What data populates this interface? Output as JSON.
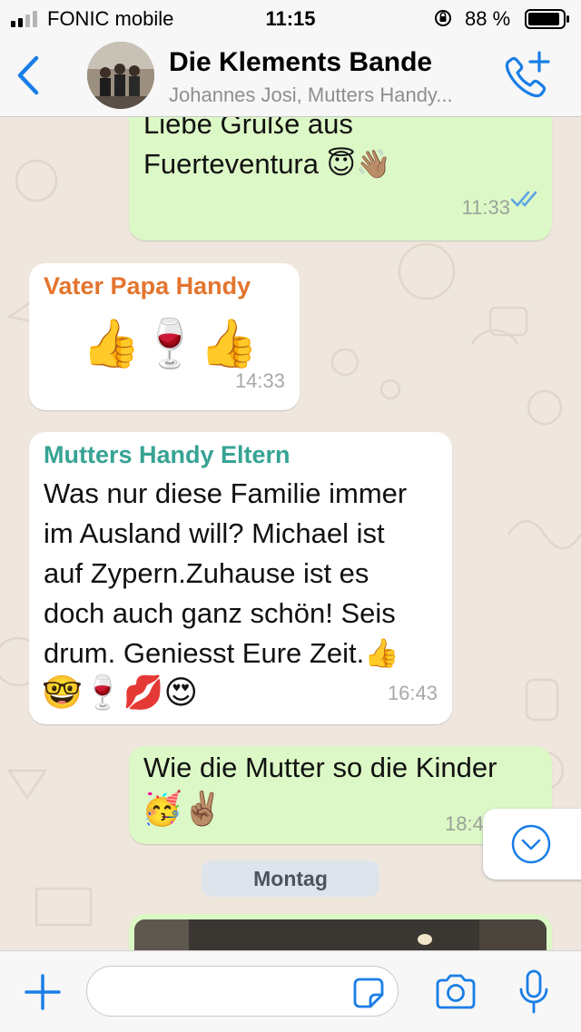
{
  "status_bar": {
    "carrier": "FONIC mobile",
    "time": "11:15",
    "battery": "88 %"
  },
  "header": {
    "title": "Die Klements Bande",
    "subtitle": "Johannes Josi, Mutters Handy...",
    "icons": {
      "back": "chevron-left-icon",
      "call": "add-call-icon"
    }
  },
  "messages": [
    {
      "direction": "out",
      "text_lines": [
        "Liebe Grüße aus",
        "Fuerteventura"
      ],
      "emojis": "😇👋🏽",
      "time": "11:33",
      "status": "read"
    },
    {
      "direction": "in",
      "sender": "Vater Papa  Handy",
      "sender_color": "#e3752f",
      "emojis": "👍🍷👍",
      "time": "14:33"
    },
    {
      "direction": "in",
      "sender": "Mutters Handy Eltern",
      "sender_color": "#37a394",
      "text_lines": [
        "Was nur diese Familie immer",
        "im Ausland will? Michael ist",
        "auf Zypern.Zuhause ist es",
        "doch auch ganz schön! Seis",
        "drum. Geniesst Eure Zeit.👍"
      ],
      "emojis": "🤓🍷💋😍",
      "time": "16:43"
    },
    {
      "direction": "out",
      "text": "Wie die Mutter so die Kinder",
      "emojis": "🥳✌🏽",
      "time": "18:4"
    }
  ],
  "date_separator": "Montag",
  "input": {
    "placeholder": "",
    "value": ""
  },
  "colors": {
    "outgoing": "#dcf8c6",
    "incoming": "#ffffff",
    "accent": "#1a7ee6"
  }
}
